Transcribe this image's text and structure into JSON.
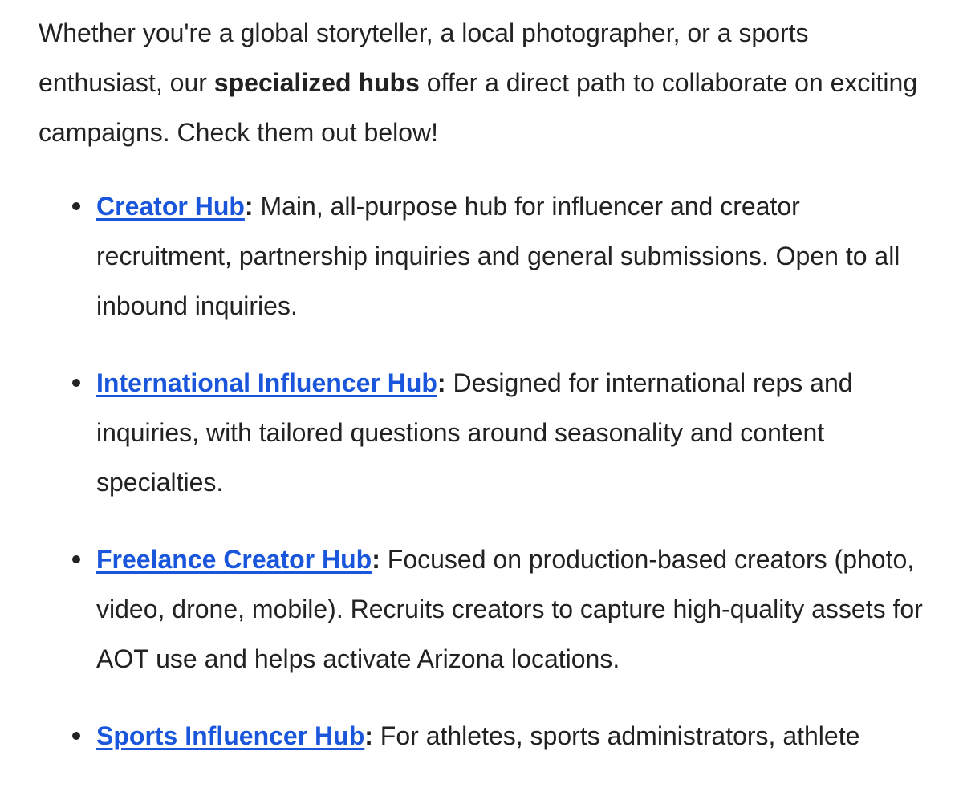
{
  "intro": {
    "before": "Whether you're a global storyteller, a local photographer, or a sports enthusiast, our ",
    "bold": "specialized hubs",
    "after": " offer a direct path to collaborate on exciting campaigns. Check them out below!"
  },
  "hubs": [
    {
      "name": "Creator Hub",
      "colon": ":",
      "description": " Main, all-purpose hub for influencer and creator recruitment, partnership inquiries and general submissions. Open to all inbound inquiries."
    },
    {
      "name": "International Influencer Hub",
      "colon": ":",
      "description": " Designed for international reps and inquiries, with tailored questions around seasonality and content specialties."
    },
    {
      "name": "Freelance Creator Hub",
      "colon": ":",
      "description": " Focused on production-based creators (photo, video, drone, mobile). Recruits creators to capture high-quality assets for AOT use and helps activate Arizona locations."
    },
    {
      "name": "Sports Influencer Hub",
      "colon": ":",
      "description": " For athletes, sports administrators, athlete"
    }
  ],
  "colors": {
    "link": "#1a56db",
    "text": "#222222",
    "background": "#ffffff"
  }
}
